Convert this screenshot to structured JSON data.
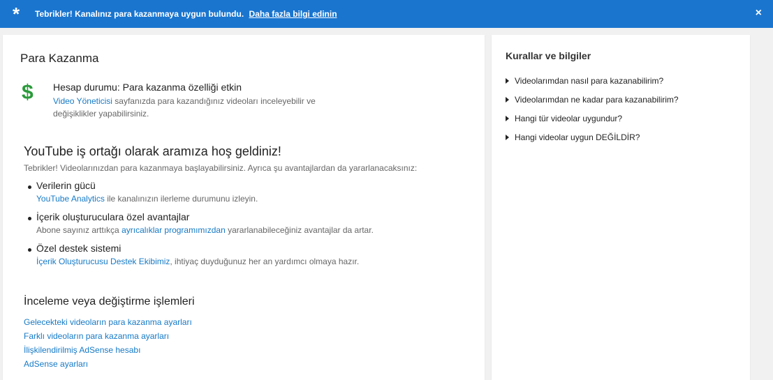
{
  "banner": {
    "icon": "asterisk-icon",
    "message": "Tebrikler! Kanalınız para kazanmaya uygun bulundu.",
    "link": "Daha fazla bilgi edinin",
    "close": "×",
    "color": "#1a75cf"
  },
  "main": {
    "title": "Para Kazanma",
    "status": {
      "icon": "dollar-icon",
      "symbol": "$",
      "heading": "Hesap durumu: Para kazanma özelliği etkin",
      "desc_link": "Video Yöneticisi",
      "desc_rest": " sayfanızda para kazandığınız videoları inceleyebilir ve",
      "desc_line2": "değişiklikler yapabilirsiniz."
    },
    "welcome": {
      "heading": "YouTube iş ortağı olarak aramıza hoş geldiniz!",
      "intro": "Tebrikler! Videolarınızdan para kazanmaya başlayabilirsiniz. Ayrıca şu avantajlardan da yararlanacaksınız:",
      "items": [
        {
          "title": "Verilerin gücü",
          "link": "YouTube Analytics",
          "pre": "",
          "post": " ile kanalınızın ilerleme durumunu izleyin."
        },
        {
          "title": "İçerik oluşturuculara özel avantajlar",
          "pre": "Abone sayınız arttıkça ",
          "link": "ayrıcalıklar programımızdan",
          "post": " yararlanabileceğiniz avantajlar da artar."
        },
        {
          "title": "Özel destek sistemi",
          "link": "İçerik Oluşturucusu Destek Ekibimiz",
          "pre": "",
          "post": ", ihtiyaç duyduğunuz her an yardımcı olmaya hazır."
        }
      ]
    },
    "actions": {
      "heading": "İnceleme veya değiştirme işlemleri",
      "links": [
        "Gelecekteki videoların para kazanma ayarları",
        "Farklı videoların para kazanma ayarları",
        "İlişkilendirilmiş AdSense hesabı",
        "AdSense ayarları"
      ]
    }
  },
  "side": {
    "title": "Kurallar ve bilgiler",
    "items": [
      "Videolarımdan nasıl para kazanabilirim?",
      "Videolarımdan ne kadar para kazanabilirim?",
      "Hangi tür videolar uygundur?",
      "Hangi videolar uygun DEĞİLDİR?"
    ]
  }
}
